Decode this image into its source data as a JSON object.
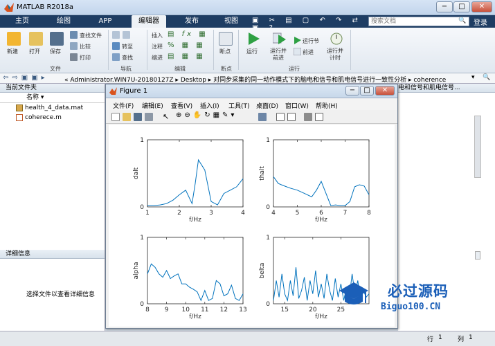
{
  "app": {
    "title": "MATLAB R2018a"
  },
  "tabs": [
    {
      "label": "主页"
    },
    {
      "label": "绘图"
    },
    {
      "label": "APP"
    },
    {
      "label": "编辑器"
    },
    {
      "label": "发布"
    },
    {
      "label": "视图"
    }
  ],
  "search": {
    "placeholder": "搜索文档"
  },
  "login_label": "登录",
  "ribbon": {
    "file": {
      "new": "新建",
      "open": "打开",
      "save": "保存",
      "find_files": "查找文件",
      "compare": "比较",
      "print": "打印",
      "section": "文件"
    },
    "nav": {
      "goto": "转至",
      "find": "查找",
      "section": "导航"
    },
    "edit": {
      "insert": "插入",
      "comment": "注释",
      "indent": "缩进",
      "section": "编辑"
    },
    "breakpoints": {
      "label": "断点",
      "section": "断点"
    },
    "run": {
      "run": "运行",
      "run_advance": "运行并\n前进",
      "run_section": "运行节",
      "advance": "前进",
      "run_time": "运行并\n计时",
      "section": "运行"
    }
  },
  "address": {
    "path": "« Administrator.WIN7U-20180127Z ▸ Desktop ▸ 对同步采集的同一动作模式下的脑电和信号和肌电信号进行一致性分析 ▸ coherence"
  },
  "current_folder": {
    "title": "当前文件夹",
    "col_name": "名称 ▾",
    "files": [
      {
        "name": "health_4_data.mat"
      },
      {
        "name": "coherece.m"
      }
    ]
  },
  "details": {
    "title": "详细信息",
    "hint": "选择文件以查看详细信息"
  },
  "right_panel": {
    "title": "电和信号和肌电信号..."
  },
  "status": {
    "row_label": "行",
    "row": "1",
    "col_label": "列",
    "col": "1"
  },
  "figure": {
    "title": "Figure 1",
    "menu": [
      "文件(F)",
      "编辑(E)",
      "查看(V)",
      "插入(I)",
      "工具(T)",
      "桌面(D)",
      "窗口(W)",
      "帮助(H)"
    ]
  },
  "watermark": {
    "text1": "必过源码",
    "text2": "Biguo100.CN"
  },
  "chart_data": [
    {
      "type": "line",
      "ylabel": "dalt",
      "xlabel": "f/Hz",
      "xlim": [
        1,
        4
      ],
      "ylim": [
        0,
        1
      ],
      "xticks": [
        1,
        2,
        3,
        4
      ],
      "yticks": [
        0,
        1
      ],
      "x": [
        1,
        1.2,
        1.4,
        1.6,
        1.8,
        2,
        2.2,
        2.4,
        2.5,
        2.6,
        2.8,
        3,
        3.2,
        3.4,
        3.6,
        3.8,
        4
      ],
      "y": [
        0.02,
        0.02,
        0.03,
        0.05,
        0.1,
        0.18,
        0.25,
        0.05,
        0.35,
        0.7,
        0.55,
        0.08,
        0.03,
        0.2,
        0.25,
        0.3,
        0.42
      ]
    },
    {
      "type": "line",
      "ylabel": "thalt",
      "xlabel": "f/Hz",
      "xlim": [
        4,
        8
      ],
      "ylim": [
        0,
        1
      ],
      "xticks": [
        4,
        5,
        6,
        7,
        8
      ],
      "yticks": [
        0,
        1
      ],
      "x": [
        4,
        4.2,
        4.4,
        4.7,
        5,
        5.3,
        5.6,
        5.8,
        6,
        6.2,
        6.4,
        6.6,
        6.8,
        7,
        7.2,
        7.4,
        7.6,
        7.8,
        8
      ],
      "y": [
        0.45,
        0.35,
        0.32,
        0.28,
        0.25,
        0.2,
        0.15,
        0.25,
        0.38,
        0.2,
        0.02,
        0.03,
        0.02,
        0.02,
        0.08,
        0.3,
        0.33,
        0.31,
        0.18
      ]
    },
    {
      "type": "line",
      "ylabel": "alpha",
      "xlabel": "f/Hz",
      "xlim": [
        8,
        13
      ],
      "ylim": [
        0,
        1
      ],
      "xticks": [
        8,
        9,
        10,
        11,
        12,
        13
      ],
      "yticks": [
        0,
        1
      ],
      "x": [
        8,
        8.2,
        8.4,
        8.6,
        8.8,
        9,
        9.2,
        9.4,
        9.6,
        9.8,
        10,
        10.2,
        10.4,
        10.6,
        10.8,
        11,
        11.2,
        11.4,
        11.6,
        11.8,
        12,
        12.2,
        12.4,
        12.6,
        12.8,
        13
      ],
      "y": [
        0.45,
        0.6,
        0.55,
        0.45,
        0.4,
        0.5,
        0.38,
        0.42,
        0.45,
        0.3,
        0.3,
        0.25,
        0.22,
        0.18,
        0.05,
        0.2,
        0.05,
        0.08,
        0.35,
        0.3,
        0.12,
        0.15,
        0.28,
        0.08,
        0.05,
        0.15
      ]
    },
    {
      "type": "line",
      "ylabel": "belta",
      "xlabel": "f/Hz",
      "xlim": [
        13,
        30
      ],
      "ylim": [
        0,
        1
      ],
      "xticks": [
        15,
        20,
        25
      ],
      "yticks": [
        0,
        1
      ],
      "x": [
        13,
        13.5,
        14,
        14.5,
        15,
        15.5,
        16,
        16.5,
        17,
        17.5,
        18,
        18.5,
        19,
        19.5,
        20,
        20.5,
        21,
        21.5,
        22,
        22.5,
        23,
        23.5,
        24,
        24.5,
        25,
        25.5,
        26,
        26.5,
        27,
        27.5,
        28,
        28.5,
        29,
        29.5,
        30
      ],
      "y": [
        0.05,
        0.35,
        0.1,
        0.45,
        0.15,
        0.05,
        0.35,
        0.12,
        0.55,
        0.08,
        0.2,
        0.4,
        0.05,
        0.35,
        0.15,
        0.5,
        0.1,
        0.3,
        0.08,
        0.45,
        0.2,
        0.05,
        0.38,
        0.1,
        0.3,
        0.05,
        0.25,
        0.1,
        0.45,
        0.15,
        0.35,
        0.05,
        0.2,
        0.1,
        0.15
      ]
    }
  ]
}
